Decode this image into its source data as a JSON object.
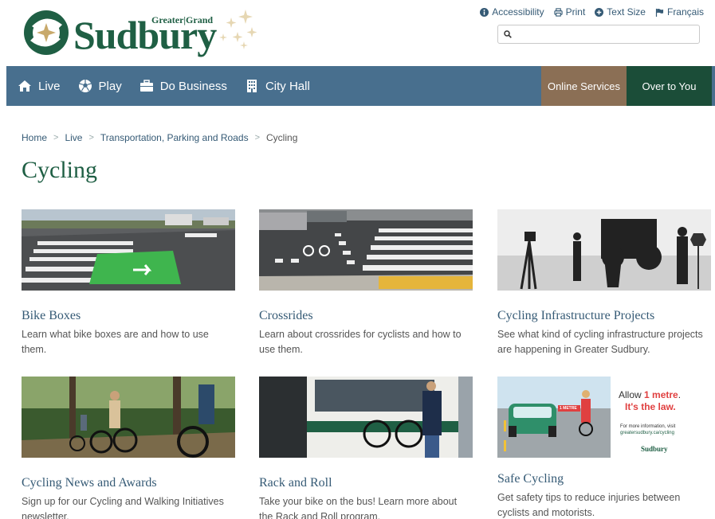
{
  "header": {
    "logo": {
      "tag": "Greater|Grand",
      "word": "Sudbury"
    },
    "utility": [
      {
        "label": "Accessibility",
        "icon": "info-icon"
      },
      {
        "label": "Print",
        "icon": "print-icon"
      },
      {
        "label": "Text Size",
        "icon": "plus-icon"
      },
      {
        "label": "Français",
        "icon": "flag-icon"
      }
    ],
    "search": {
      "placeholder": ""
    }
  },
  "nav": {
    "items": [
      {
        "label": "Live",
        "icon": "home-icon"
      },
      {
        "label": "Play",
        "icon": "ball-icon"
      },
      {
        "label": "Do Business",
        "icon": "briefcase-icon"
      },
      {
        "label": "City Hall",
        "icon": "building-icon"
      }
    ],
    "online_services": "Online Services",
    "over_to_you": "Over to You"
  },
  "breadcrumb": [
    "Home",
    "Live",
    "Transportation, Parking and Roads",
    "Cycling"
  ],
  "page_title": "Cycling",
  "cards": [
    {
      "title": "Bike Boxes",
      "desc": "Learn what bike boxes are and how to use them."
    },
    {
      "title": "Crossrides",
      "desc": "Learn about crossrides for cyclists and how to use them."
    },
    {
      "title": "Cycling Infrastructure Projects",
      "desc": "See what kind of cycling infrastructure projects are happening in Greater Sudbury."
    },
    {
      "title": "Cycling News and Awards",
      "desc": "Sign up for our Cycling and Walking Initiatives newsletter."
    },
    {
      "title": "Rack and Roll",
      "desc": "Take your bike on the bus! Learn more about the Rack and Roll program."
    },
    {
      "title": "Safe Cycling",
      "desc": "Get safety tips to reduce injuries between cyclists and motorists."
    }
  ],
  "safe_cycling_image": {
    "line1a": "Allow ",
    "line1b": "1 metre",
    "line1c": ".",
    "line2": "It's the law.",
    "info1": "For more information, visit",
    "info2": "greatersudbury.ca/cycling",
    "sign": "1 METRE",
    "brand": "Sudbury"
  },
  "colors": {
    "nav": "#486f8e",
    "online": "#8b6f55",
    "over": "#1b4d38",
    "brand_green": "#1f5f44",
    "link": "#355a75"
  }
}
